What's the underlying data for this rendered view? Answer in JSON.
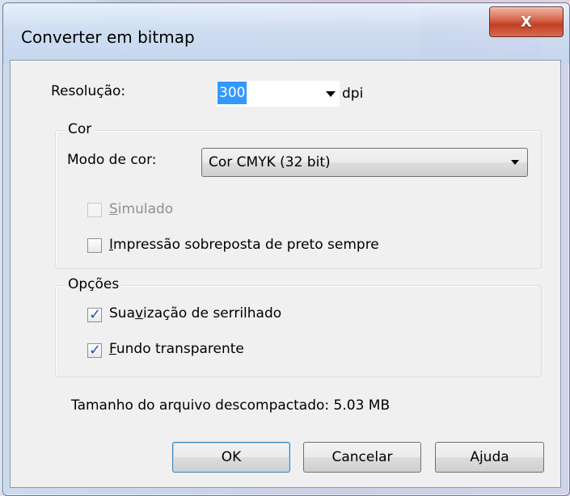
{
  "window": {
    "title": "Converter em bitmap",
    "close_glyph": "X"
  },
  "resolution": {
    "label": "Resolução:",
    "value": "300",
    "unit": "dpi"
  },
  "color_group": {
    "title": "Cor",
    "mode_label": "Modo de cor:",
    "mode_value": "Cor CMYK (32 bit)",
    "simulated": {
      "label_prefix": "",
      "label_underlined": "S",
      "label_suffix": "imulado",
      "checked": false,
      "enabled": false
    },
    "overprint": {
      "label_underlined": "I",
      "label_suffix": "mpressão sobreposta de preto sempre",
      "checked": false,
      "enabled": true
    }
  },
  "options_group": {
    "title": "Opções",
    "anti_alias": {
      "label_prefix": "Sua",
      "label_underlined": "v",
      "label_suffix": "ização de serrilhado",
      "checked": true
    },
    "transparent_bg": {
      "label_underlined": "F",
      "label_suffix": "undo transparente",
      "checked": true
    }
  },
  "file_size": {
    "text": "Tamanho do arquivo descompactado: 5.03 MB"
  },
  "buttons": {
    "ok": "OK",
    "cancel": "Cancelar",
    "help": "Ajuda"
  },
  "colors": {
    "selection": "#3399ff",
    "close_button": "#c13f25",
    "checkmark": "#2459a8"
  }
}
